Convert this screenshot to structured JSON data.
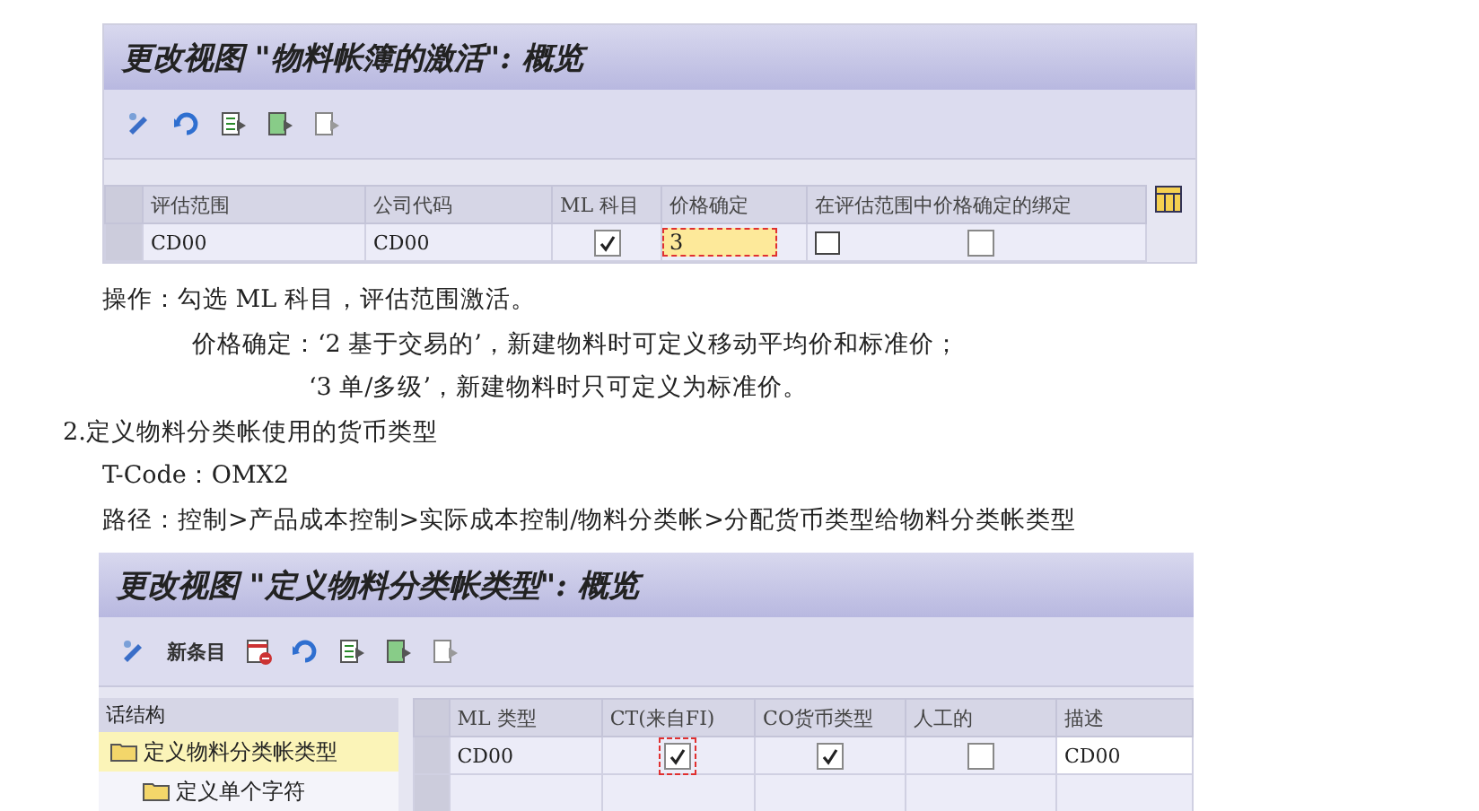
{
  "screen_1": {
    "title": "更改视图 \"物料帐簿的激活\": 概览",
    "table": {
      "columns": [
        "评估范围",
        "公司代码",
        "ML 科目",
        "价格确定",
        "在评估范围中价格确定的绑定"
      ],
      "rows": [
        {
          "valuation_area": "CD00",
          "company_code": "CD00",
          "ml_active": true,
          "price_determination": "3",
          "binding": false
        }
      ]
    }
  },
  "text_lines": [
    {
      "kind": "normal",
      "text": "操作：勾选 ML 科目，评估范围激活。"
    },
    {
      "kind": "indent",
      "text": "价格确定：‘2 基于交易的’，新建物料时可定义移动平均价和标准价；"
    },
    {
      "kind": "indent2",
      "text": "‘3 单/多级’，新建物料时只可定义为标准价。"
    },
    {
      "kind": "heading",
      "text": "2.定义物料分类帐使用的货币类型"
    },
    {
      "kind": "normal",
      "text": "T-Code：OMX2"
    },
    {
      "kind": "normal",
      "text": "路径：控制>产品成本控制>实际成本控制/物料分类帐>分配货币类型给物料分类帐类型"
    }
  ],
  "screen_2": {
    "title": "更改视图 \"定义物料分类帐类型\": 概览",
    "new_entries_button": "新条目",
    "tree": {
      "header": "话结构",
      "items": [
        {
          "label": "定义物料分类帐类型",
          "selected": true,
          "children": [
            {
              "label": "定义单个字符",
              "selected": false
            }
          ]
        }
      ]
    },
    "table": {
      "columns": [
        "ML 类型",
        "CT(来自FI)",
        "CO货币类型",
        "人工的",
        "描述"
      ],
      "rows": [
        {
          "ml_type": "CD00",
          "ct_from_fi": true,
          "co_currency_type": true,
          "manual": false,
          "description": "CD00"
        }
      ]
    }
  }
}
